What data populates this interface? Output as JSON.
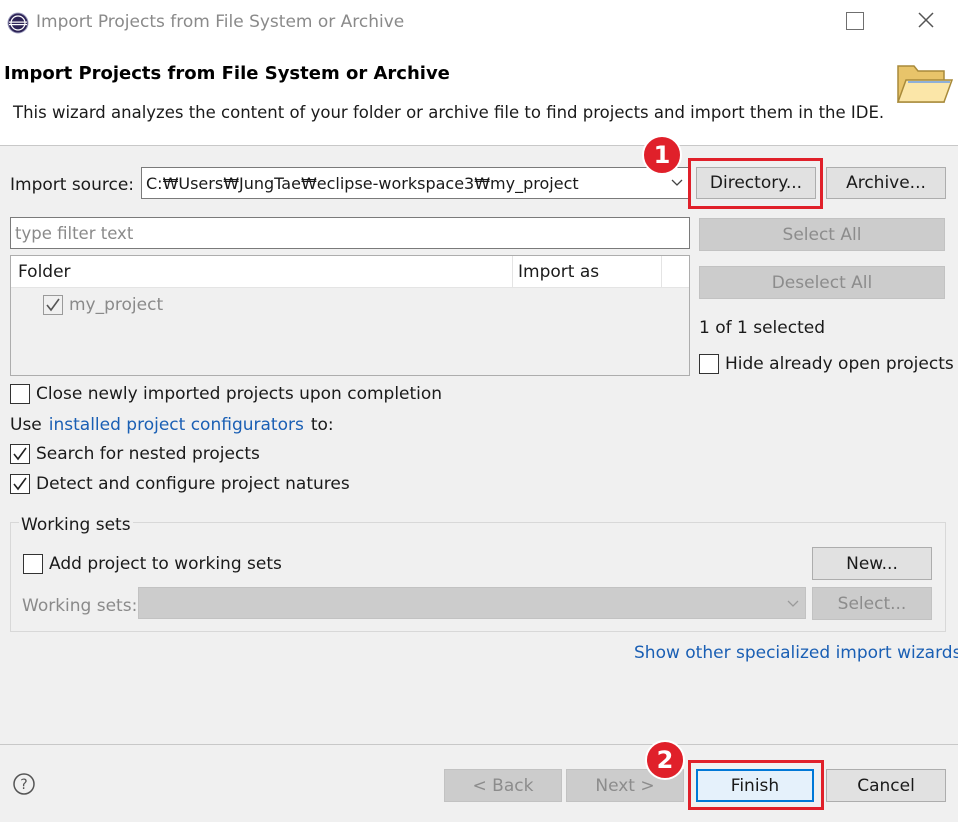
{
  "window": {
    "title": "Import Projects from File System or Archive"
  },
  "header": {
    "title": "Import Projects from File System or Archive",
    "description": "This wizard analyzes the content of your folder or archive file to find projects and import them in the IDE."
  },
  "import_source": {
    "label": "Import source:",
    "value": "C:₩Users₩JungTae₩eclipse-workspace3₩my_project",
    "directory_button": "Directory...",
    "archive_button": "Archive..."
  },
  "filter": {
    "placeholder": "type filter text"
  },
  "table": {
    "columns": [
      "Folder",
      "Import as"
    ],
    "rows": [
      {
        "folder": "my_project",
        "import_as": "",
        "checked": true
      }
    ]
  },
  "side": {
    "select_all": "Select All",
    "deselect_all": "Deselect All",
    "selected_count": "1 of 1 selected",
    "hide_open": "Hide already open projects",
    "hide_open_checked": false
  },
  "options": {
    "close_newly": "Close newly imported projects upon completion",
    "close_newly_checked": false,
    "use_prefix": "Use",
    "configurators_link": "installed project configurators",
    "use_suffix": "to:",
    "search_nested": "Search for nested projects",
    "search_nested_checked": true,
    "detect_natures": "Detect and configure project natures",
    "detect_natures_checked": true
  },
  "working_sets": {
    "group_label": "Working sets",
    "add_label": "Add project to working sets",
    "add_checked": false,
    "new_button": "New...",
    "sets_label": "Working sets:",
    "select_button": "Select..."
  },
  "links": {
    "other_wizards": "Show other specialized import wizards"
  },
  "footer": {
    "back": "< Back",
    "next": "Next >",
    "finish": "Finish",
    "cancel": "Cancel"
  },
  "annotations": {
    "marker_1": "1",
    "marker_2": "2",
    "color": "#e0202a"
  },
  "icons": {
    "app": "eclipse-icon",
    "help": "help-icon",
    "banner": "folder-icon"
  }
}
